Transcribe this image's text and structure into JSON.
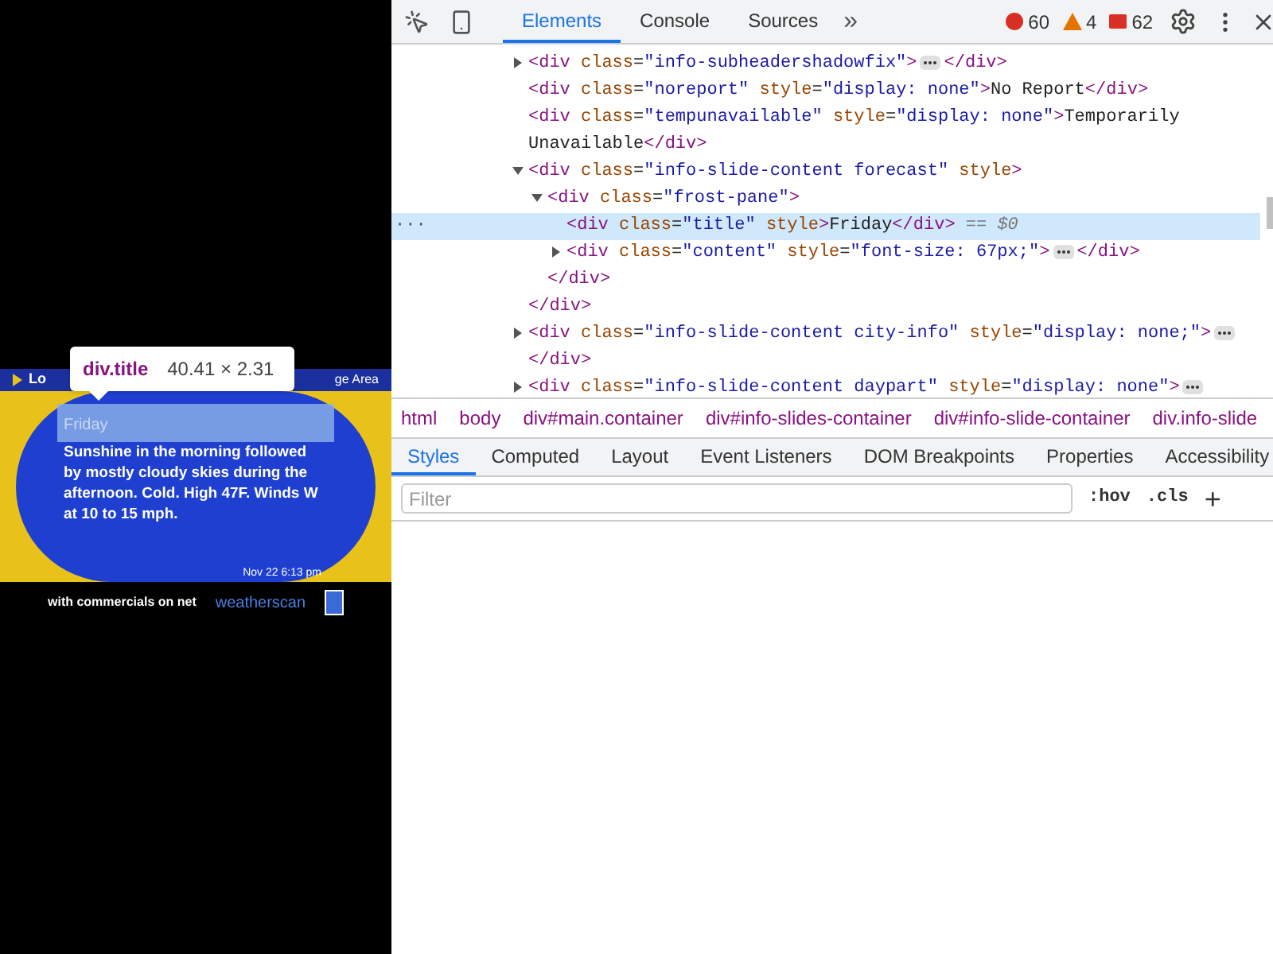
{
  "preview": {
    "header_left": "Lo",
    "header_right": "ge Area",
    "title": "Friday",
    "forecast": "Sunshine in the morning followed by mostly cloudy skies during the afternoon. Cold. High 47F. Winds W at 10 to 15 mph.",
    "timestamp": "Nov 22  6:13 pm",
    "ticker": "with commercials on net",
    "brand": "weatherscan",
    "tooltip": {
      "selector": "div.title",
      "size": "40.41 × 2.31"
    }
  },
  "toolbar": {
    "tabs": [
      {
        "label": "Elements",
        "selected": true
      },
      {
        "label": "Console",
        "selected": false
      },
      {
        "label": "Sources",
        "selected": false
      }
    ],
    "more": "»",
    "errors": "60",
    "warnings": "4",
    "issues": "62"
  },
  "dom_tree": [
    {
      "markup": "<div class=\"info-subheadershadowfix\">",
      "expanded": false,
      "closing": "</div>",
      "selected": false
    },
    {
      "markup": "<div class=\"noreport\" style=\"display: none\">No Report</div>",
      "selected": false
    },
    {
      "markup": "<div class=\"tempunavailable\" style=\"display: none\">Temporarily Unavailable</div>",
      "selected": false
    },
    {
      "markup": "<div class=\"info-slide-content forecast\" style>",
      "expanded": true,
      "selected": false,
      "closing": "</div>",
      "children": [
        {
          "markup": "<div class=\"frost-pane\">",
          "expanded": true,
          "selected": false,
          "closing": "</div>",
          "children": [
            {
              "markup": "<div class=\"title\" style>Friday</div>",
              "selected": true,
              "suffix": "== $0"
            },
            {
              "markup": "<div class=\"content\" style=\"font-size: 67px;\">",
              "expanded": false,
              "closing": "</div>",
              "selected": false
            }
          ]
        }
      ]
    },
    {
      "markup": "<div class=\"info-slide-content city-info\" style=\"display: none;\">",
      "expanded": false,
      "closing": "</div>",
      "selected": false
    },
    {
      "markup": "<div class=\"info-slide-content daypart\" style=\"display: none\">",
      "expanded": false,
      "selected": false
    }
  ],
  "row_menu": "···",
  "breadcrumbs": [
    "html",
    "body",
    "div#main.container",
    "div#info-slides-container",
    "div#info-slide-container",
    "div.info-slide"
  ],
  "panel_tabs": [
    {
      "label": "Styles",
      "selected": true
    },
    {
      "label": "Computed",
      "selected": false
    },
    {
      "label": "Layout",
      "selected": false
    },
    {
      "label": "Event Listeners",
      "selected": false
    },
    {
      "label": "DOM Breakpoints",
      "selected": false
    },
    {
      "label": "Properties",
      "selected": false
    },
    {
      "label": "Accessibility",
      "selected": false
    }
  ],
  "filter": {
    "placeholder": "Filter"
  },
  "hov": ":hov",
  "cls": ".cls",
  "add": "+"
}
